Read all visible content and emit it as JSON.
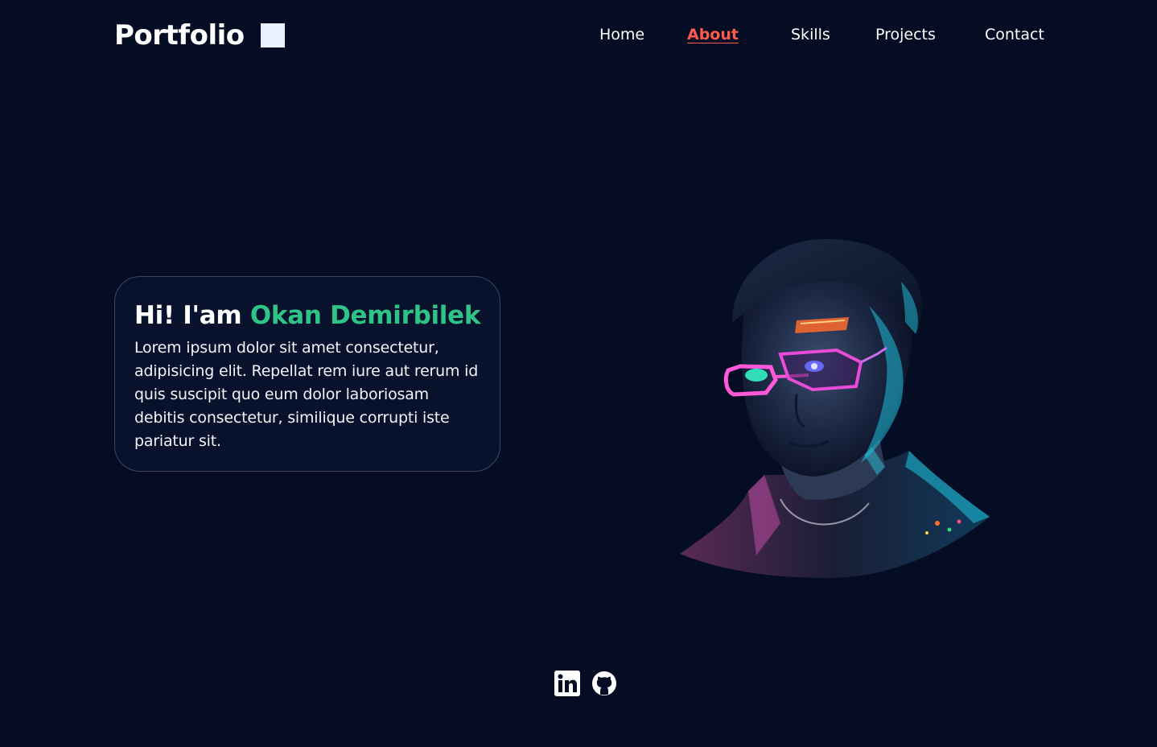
{
  "header": {
    "logo_text": "Portfolio",
    "nav": [
      {
        "label": "Home",
        "active": false
      },
      {
        "label": "About",
        "active": true
      },
      {
        "label": "Skills",
        "active": false
      },
      {
        "label": "Projects",
        "active": false
      },
      {
        "label": "Contact",
        "active": false
      }
    ]
  },
  "intro": {
    "greeting": "Hi! I'am",
    "name": "Okan Demirbilek",
    "body": "Lorem ipsum dolor sit amet consectetur, adipisicing elit. Repellat rem iure aut rerum id quis suscipit quo eum dolor laboriosam debitis consectetur, similique corrupti iste pariatur sit."
  },
  "social": {
    "icons": [
      "linkedin-icon",
      "github-icon"
    ]
  },
  "colors": {
    "background": "#050d24",
    "accent_name": "#2ec487",
    "active_nav": "#ff5a4e"
  }
}
